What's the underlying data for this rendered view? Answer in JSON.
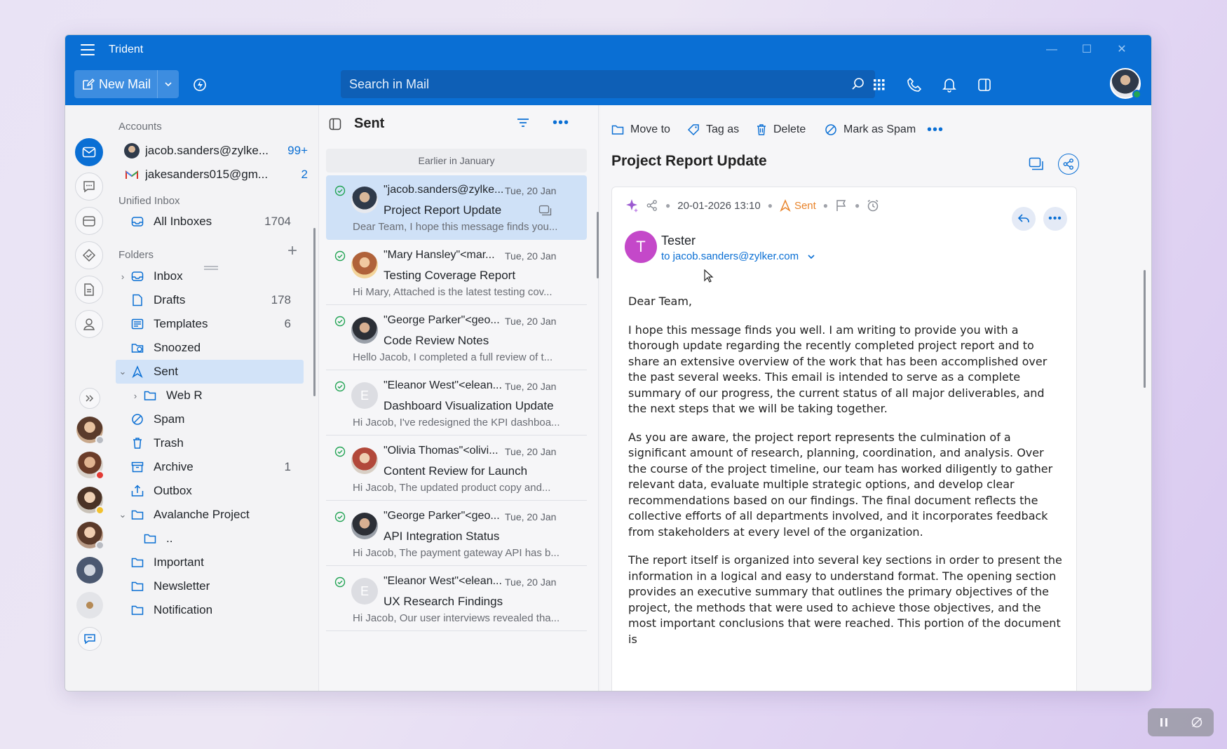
{
  "app": {
    "title": "Trident",
    "new_mail_label": "New Mail",
    "search_placeholder": "Search in Mail"
  },
  "accounts": {
    "label": "Accounts",
    "items": [
      {
        "name": "jacob.sanders@zylke...",
        "count": "99+"
      },
      {
        "name": "jakesanders015@gm...",
        "count": "2"
      }
    ]
  },
  "unified": {
    "label": "Unified Inbox",
    "all_inboxes": {
      "name": "All Inboxes",
      "count": "1704"
    }
  },
  "folders": {
    "label": "Folders",
    "items": [
      {
        "name": "Inbox",
        "count": ""
      },
      {
        "name": "Drafts",
        "count": "178"
      },
      {
        "name": "Templates",
        "count": "6"
      },
      {
        "name": "Snoozed",
        "count": ""
      },
      {
        "name": "Sent",
        "count": ""
      },
      {
        "name": "Web R",
        "count": ""
      },
      {
        "name": "Spam",
        "count": ""
      },
      {
        "name": "Trash",
        "count": ""
      },
      {
        "name": "Archive",
        "count": "1"
      },
      {
        "name": "Outbox",
        "count": ""
      },
      {
        "name": "Avalanche Project",
        "count": ""
      },
      {
        "name": "..",
        "count": ""
      },
      {
        "name": "Important",
        "count": ""
      },
      {
        "name": "Newsletter",
        "count": ""
      },
      {
        "name": "Notification",
        "count": ""
      }
    ]
  },
  "list": {
    "title": "Sent",
    "group_header": "Earlier in January",
    "messages": [
      {
        "from": "\"jacob.sanders@zylke...",
        "date": "Tue, 20 Jan",
        "subject": "Project Report Update",
        "preview": "Dear Team, I hope this message finds you..."
      },
      {
        "from": "\"Mary Hansley\"<mar...",
        "date": "Tue, 20 Jan",
        "subject": "Testing Coverage Report",
        "preview": "Hi Mary, Attached is the latest testing cov..."
      },
      {
        "from": "\"George Parker\"<geo...",
        "date": "Tue, 20 Jan",
        "subject": "Code Review Notes",
        "preview": "Hello Jacob, I completed a full review of t..."
      },
      {
        "from": "\"Eleanor West\"<elean...",
        "date": "Tue, 20 Jan",
        "subject": "Dashboard Visualization Update",
        "preview": "Hi Jacob, I've redesigned the KPI dashboa...",
        "initial": "E"
      },
      {
        "from": "\"Olivia Thomas\"<olivi...",
        "date": "Tue, 20 Jan",
        "subject": "Content Review for Launch",
        "preview": "Hi Jacob, The updated product copy and..."
      },
      {
        "from": "\"George Parker\"<geo...",
        "date": "Tue, 20 Jan",
        "subject": "API Integration Status",
        "preview": "Hi Jacob, The payment gateway API has b..."
      },
      {
        "from": "\"Eleanor West\"<elean...",
        "date": "Tue, 20 Jan",
        "subject": "UX Research Findings",
        "preview": "Hi Jacob, Our user interviews revealed tha...",
        "initial": "E"
      }
    ]
  },
  "reader": {
    "toolbar": {
      "move_to": "Move to",
      "tag_as": "Tag as",
      "delete": "Delete",
      "mark_spam": "Mark as Spam"
    },
    "subject": "Project Report Update",
    "datetime": "20-01-2026 13:10",
    "status": "Sent",
    "sender_initial": "T",
    "sender_name": "Tester",
    "to_line": "to jacob.sanders@zylker.com",
    "body": [
      "Dear Team,",
      "I hope this message finds you well. I am writing to provide you with a thorough update regarding the recently completed project report and to share an extensive overview of the work that has been accomplished over the past several weeks. This email is intended to serve as a complete summary of our progress, the current status of all major deliverables, and the next steps that we will be taking together.",
      "As you are aware, the project report represents the culmination of a significant amount of research, planning, coordination, and analysis. Over the course of the project timeline, our team has worked diligently to gather relevant data, evaluate multiple strategic options, and develop clear recommendations based on our findings. The final document reflects the collective efforts of all departments involved, and it incorporates feedback from stakeholders at every level of the organization.",
      "The report itself is organized into several key sections in order to present the information in a logical and easy to understand format. The opening section provides an executive summary that outlines the primary objectives of the project, the methods that were used to achieve those objectives, and the most important conclusions that were reached. This portion of the document is"
    ]
  },
  "colors": {
    "accent": "#0a6fd4",
    "sent_status": "#e8832a",
    "sender_avatar": "#c448c9",
    "selection": "#d2e3f8"
  }
}
